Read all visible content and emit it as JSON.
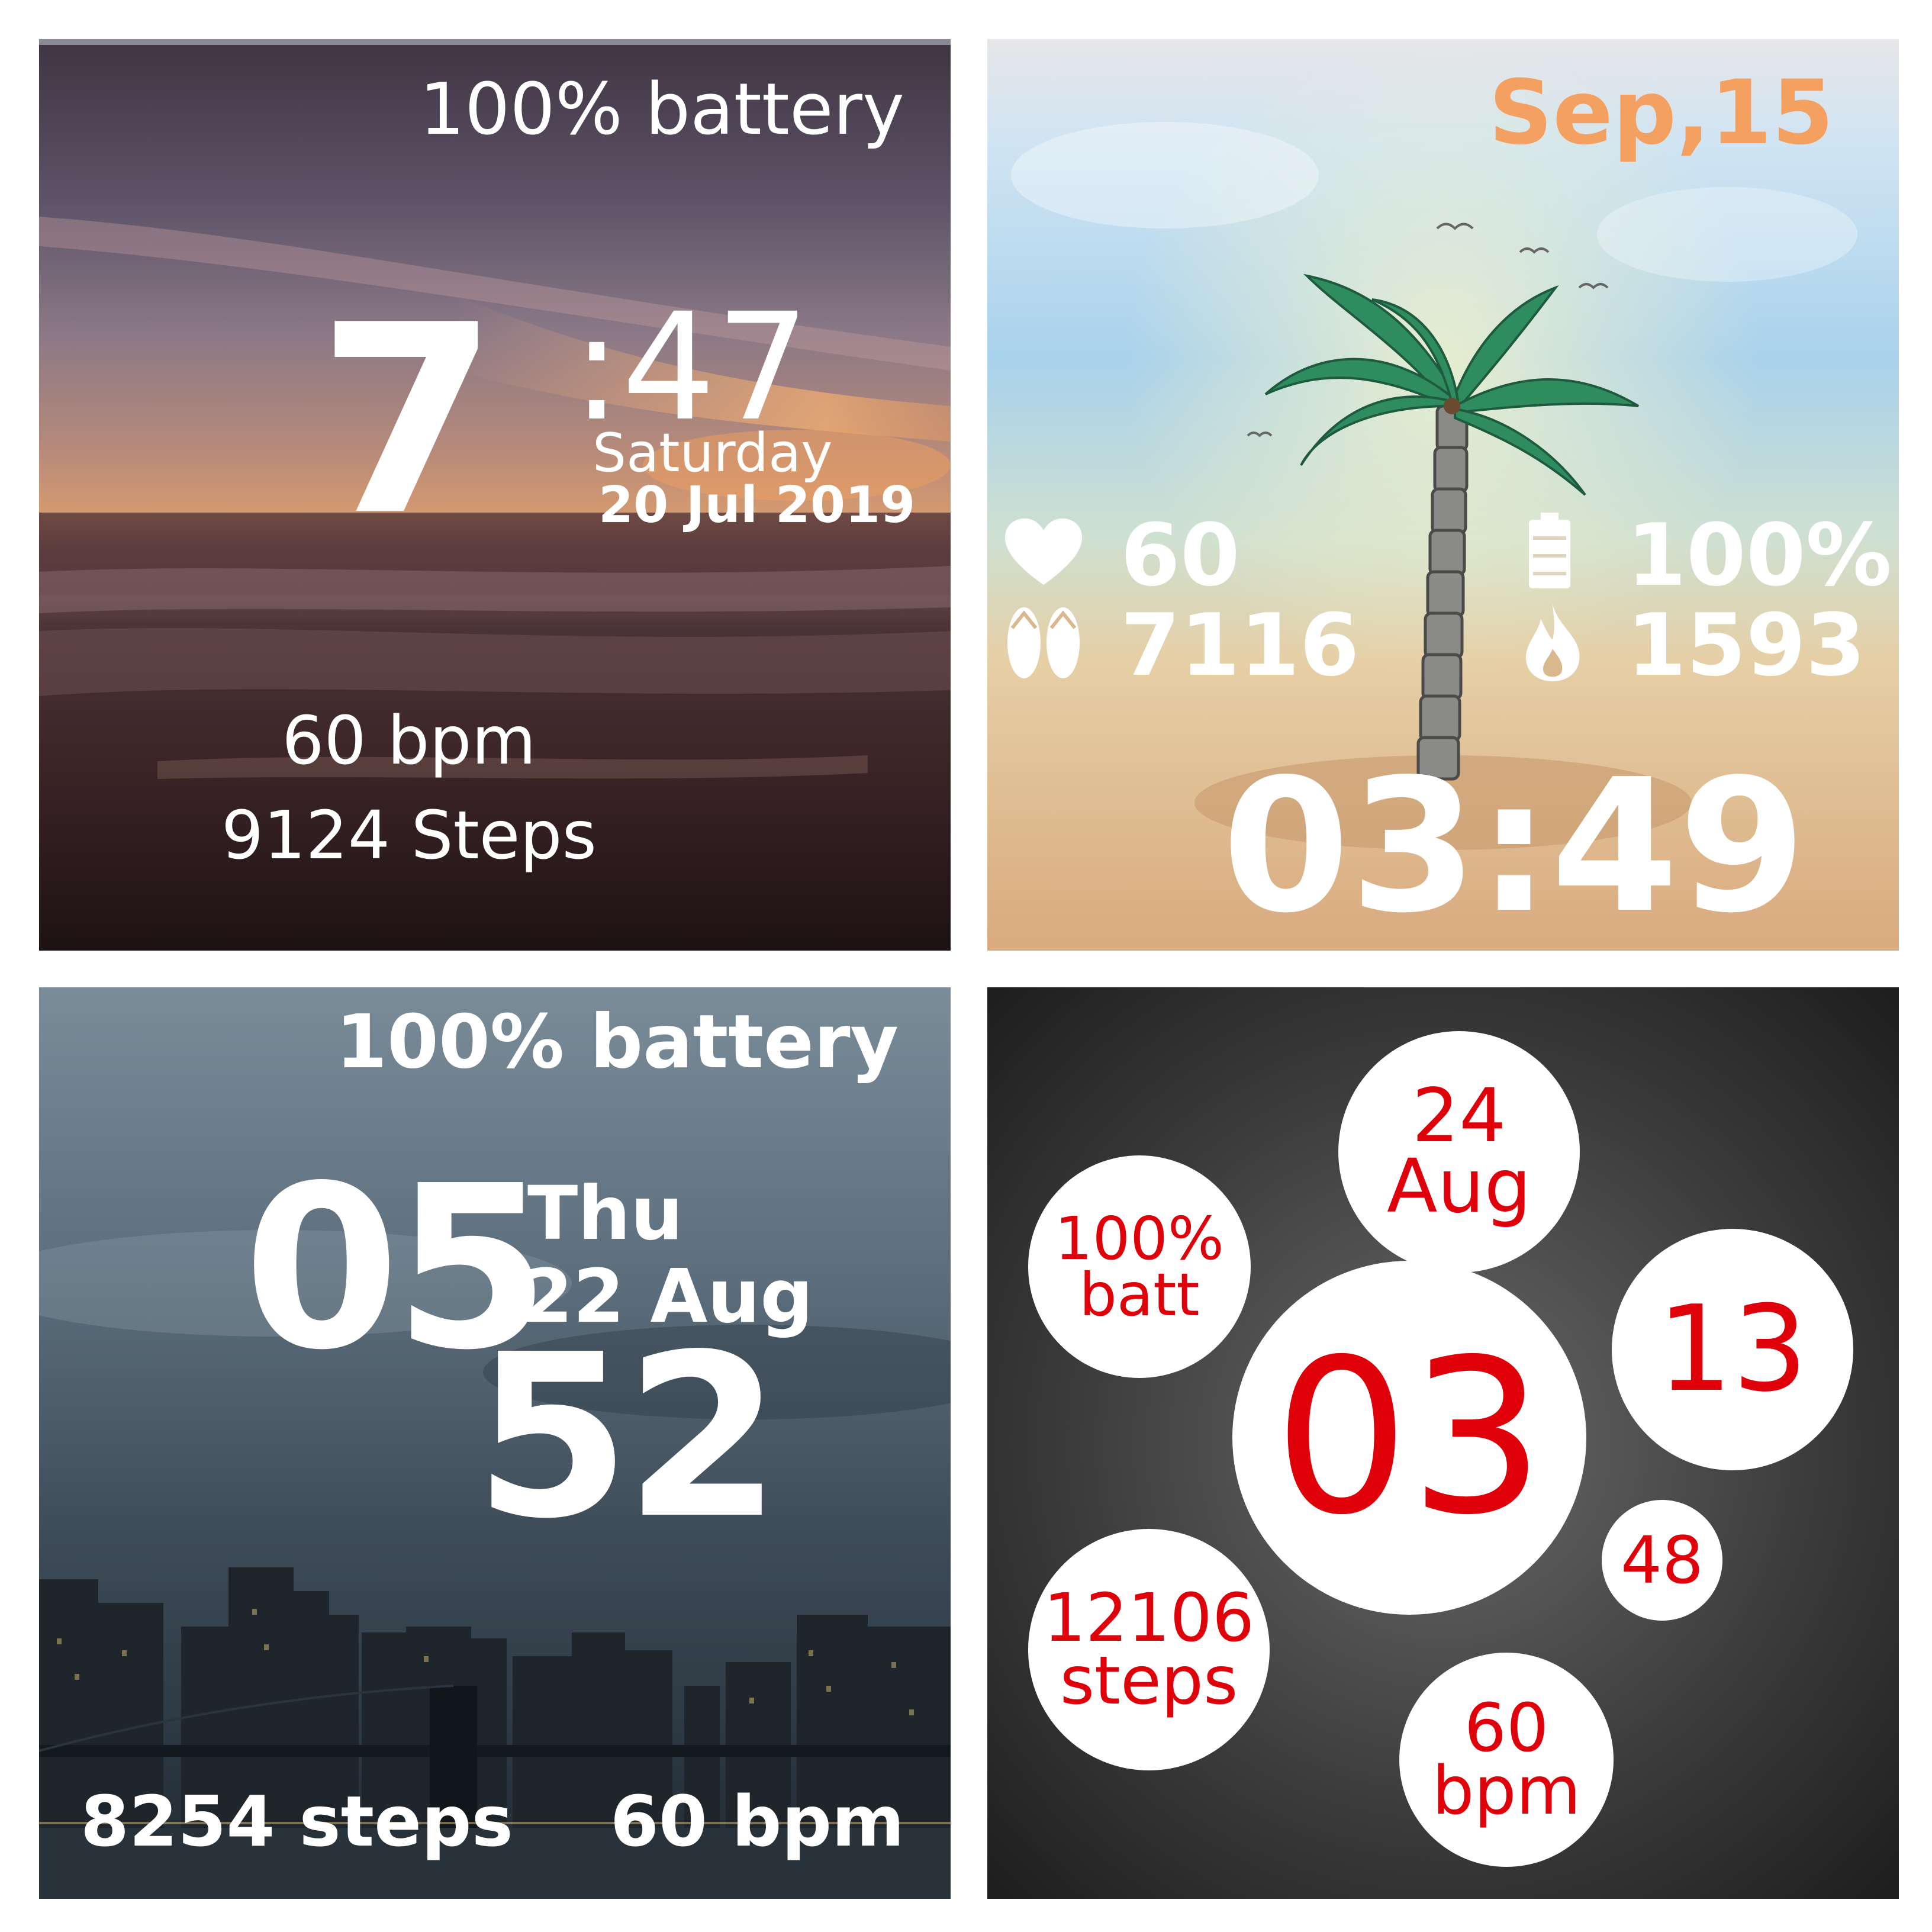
{
  "faces": {
    "beach_sunset": {
      "battery": "100% battery",
      "hour": "7",
      "minute": ":47",
      "weekday": "Saturday",
      "date": "20 Jul 2019",
      "heart_rate": "60 bpm",
      "steps": "9124 Steps"
    },
    "palm_tree": {
      "date": "Sep,15",
      "heart_rate": "60",
      "steps": "7116",
      "battery": "100%",
      "calories": "1593",
      "time": "03:49",
      "icons": [
        "heart-icon",
        "flip-flops-icon",
        "battery-icon",
        "flame-icon"
      ],
      "date_color": "#f4a060"
    },
    "city_skyline": {
      "battery": "100% battery",
      "hour": "05",
      "minute": "52",
      "weekday": "Thu",
      "date": "22 Aug",
      "steps": "8254 steps",
      "heart_rate": "60 bpm"
    },
    "bubbles": {
      "day": "24",
      "month": "Aug",
      "battery_value": "100%",
      "battery_label": "batt",
      "hour": "03",
      "minute": "13",
      "second": "48",
      "steps_value": "12106",
      "steps_label": "steps",
      "heart_value": "60",
      "heart_label": "bpm",
      "text_color": "#e0000a"
    }
  }
}
